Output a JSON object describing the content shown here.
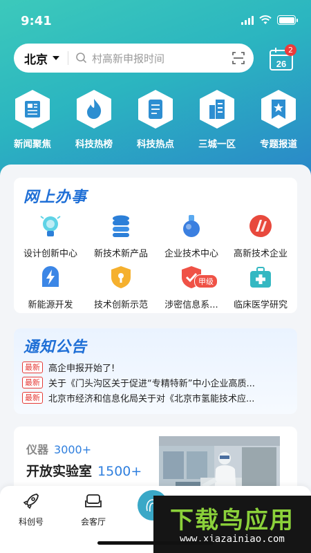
{
  "status_bar": {
    "time": "9:41"
  },
  "search": {
    "city": "北京",
    "placeholder": "村高新申报时间"
  },
  "calendar": {
    "day": "26",
    "badge": "2"
  },
  "quick_nav": [
    {
      "label": "新闻聚焦",
      "icon": "news-icon"
    },
    {
      "label": "科技热榜",
      "icon": "flame-icon"
    },
    {
      "label": "科技热点",
      "icon": "document-icon"
    },
    {
      "label": "三城一区",
      "icon": "building-icon"
    },
    {
      "label": "专题报道",
      "icon": "star-bookmark-icon"
    }
  ],
  "services": {
    "title": "网上办事",
    "items": [
      {
        "label": "设计创新中心",
        "icon": "lightbulb-icon"
      },
      {
        "label": "新技术新产品",
        "icon": "database-icon"
      },
      {
        "label": "企业技术中心",
        "icon": "flask-icon"
      },
      {
        "label": "高新技术企业",
        "icon": "hightech-logo-icon"
      },
      {
        "label": "新能源开发",
        "icon": "lightning-icon"
      },
      {
        "label": "技术创新示范",
        "icon": "lock-shield-icon"
      },
      {
        "label": "涉密信息系...",
        "icon": "shield-check-icon",
        "badge": "甲级"
      },
      {
        "label": "临床医学研究",
        "icon": "medical-kit-icon"
      }
    ]
  },
  "notices": {
    "title": "通知公告",
    "tag": "最新",
    "items": [
      "高企申报开始了!",
      "关于《门头沟区关于促进“专精特新”中小企业高质...",
      "北京市经济和信息化局关于对《北京市氢能技术应..."
    ]
  },
  "lab": {
    "instrument_label": "仪器",
    "instrument_count": "3000+",
    "lab_label": "开放实验室",
    "lab_count": "1500+"
  },
  "tabbar": [
    {
      "label": "科创号",
      "icon": "rocket-icon"
    },
    {
      "label": "会客厅",
      "icon": "sofa-icon"
    }
  ],
  "watermark": {
    "title": "下载鸟应用",
    "url": "www.xiazainiao.com"
  },
  "colors": {
    "accent": "#1f6fd6",
    "header_start": "#3cc9bb",
    "header_end": "#2a86c9",
    "tag_red": "#e53935"
  }
}
